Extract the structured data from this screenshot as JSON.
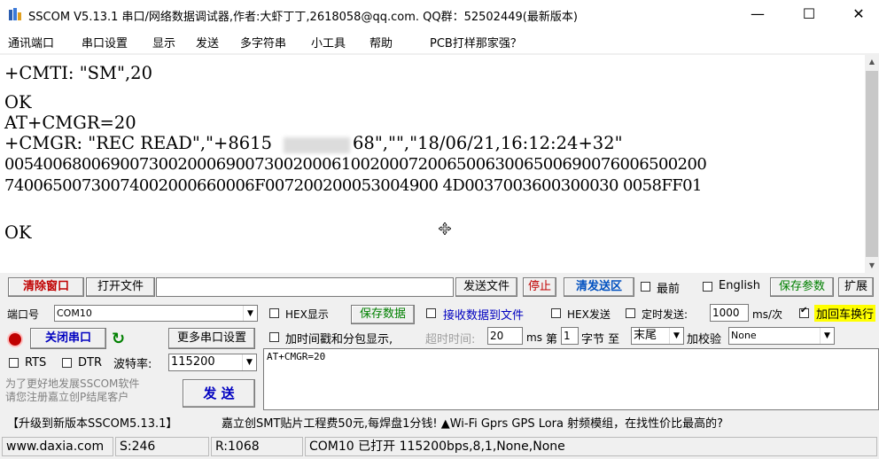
{
  "window": {
    "title": "SSCOM V5.13.1 串口/网络数据调试器,作者:大虾丁丁,2618058@qq.com. QQ群：52502449(最新版本)",
    "minimize": "—",
    "maximize": "☐",
    "close": "✕"
  },
  "menu": [
    "通讯端口",
    "串口设置",
    "显示",
    "发送",
    "多字符串",
    "小工具",
    "帮助",
    "PCB打样那家强？"
  ],
  "terminal": {
    "lines": [
      "+CMTI: \"SM\",20",
      "OK",
      "AT+CMGR=20",
      "+CMGR: \"REC READ\",\"+8615",
      "68\",\"\",\"18/06/21,16:12:24+32\"",
      "0054006800690073002000690073002000610020007200650063006500690076006500200",
      "74006500730074002000660006F007200200053004900 4D0037003600300030 0058FF01",
      "OK"
    ]
  },
  "toolbar": {
    "clear_window": "清除窗口",
    "open_file": "打开文件",
    "file_path": "",
    "send_file": "发送文件",
    "stop": "停止",
    "clear_send": "清发送区",
    "top_most": "最前",
    "english": "English",
    "save_params": "保存参数",
    "expand": "扩展"
  },
  "port": {
    "port_label": "端口号",
    "port_value": "COM10",
    "hex_display": "HEX显示",
    "save_data": "保存数据",
    "recv_to_file": "接收数据到文件",
    "hex_send": "HEX发送",
    "timed_send": "定时发送:",
    "interval_value": "1000",
    "interval_unit": "ms/次",
    "add_crlf": "加回车换行",
    "close_port": "关闭串口",
    "more_ports": "更多串口设置",
    "timestamp": "加时间戳和分包显示,",
    "timeout_label": "超时时间:",
    "timeout_value": "20",
    "timeout_unit": "ms",
    "byte_nth": "第",
    "byte_value": "1",
    "byte_unit": "字节 至",
    "byte_end": "末尾",
    "checksum_label": "加校验",
    "checksum_value": "None",
    "rts": "RTS",
    "dtr": "DTR",
    "baud_label": "波特率:",
    "baud_value": "115200",
    "promo_side": "为了更好地发展SSCOM软件\n请您注册嘉立创P结尾客户",
    "send": "发 送",
    "send_text": "AT+CMGR=20"
  },
  "promo": {
    "upgrade": "【升级到新版本SSCOM5.13.1】",
    "ad": "嘉立创SMT贴片工程费50元,每焊盘1分钱! ▲Wi-Fi Gprs GPS Lora 射频模组，在找性价比最高的?"
  },
  "status": {
    "site": "www.daxia.com",
    "sent": "S:246",
    "received": "R:1068",
    "port_status": "COM10 已打开  115200bps,8,1,None,None"
  }
}
